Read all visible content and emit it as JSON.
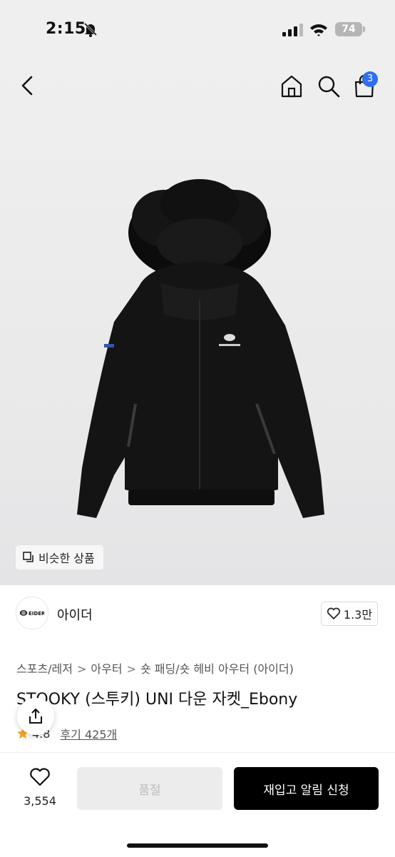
{
  "status_bar": {
    "time": "2:15",
    "battery": "74"
  },
  "nav": {
    "cart_count": "3"
  },
  "hero": {
    "similar_label": "비슷한 상품"
  },
  "brand": {
    "name": "아이더",
    "logo_text": "EIDER",
    "likes": "1.3만"
  },
  "breadcrumb": [
    "스포츠/레저",
    "아우터",
    "숏 패딩/숏 헤비 아우터 (아이더)"
  ],
  "product": {
    "title": "STOOKY (스투키) UNI 다운 자켓_Ebony",
    "rating": "4.8",
    "reviews": "후기 425개"
  },
  "bottom": {
    "wish_count": "3,554",
    "soldout_label": "품절",
    "restock_label": "재입고 알림 신청"
  },
  "colors": {
    "accent": "#2f6ff0",
    "star": "#f5a623"
  }
}
